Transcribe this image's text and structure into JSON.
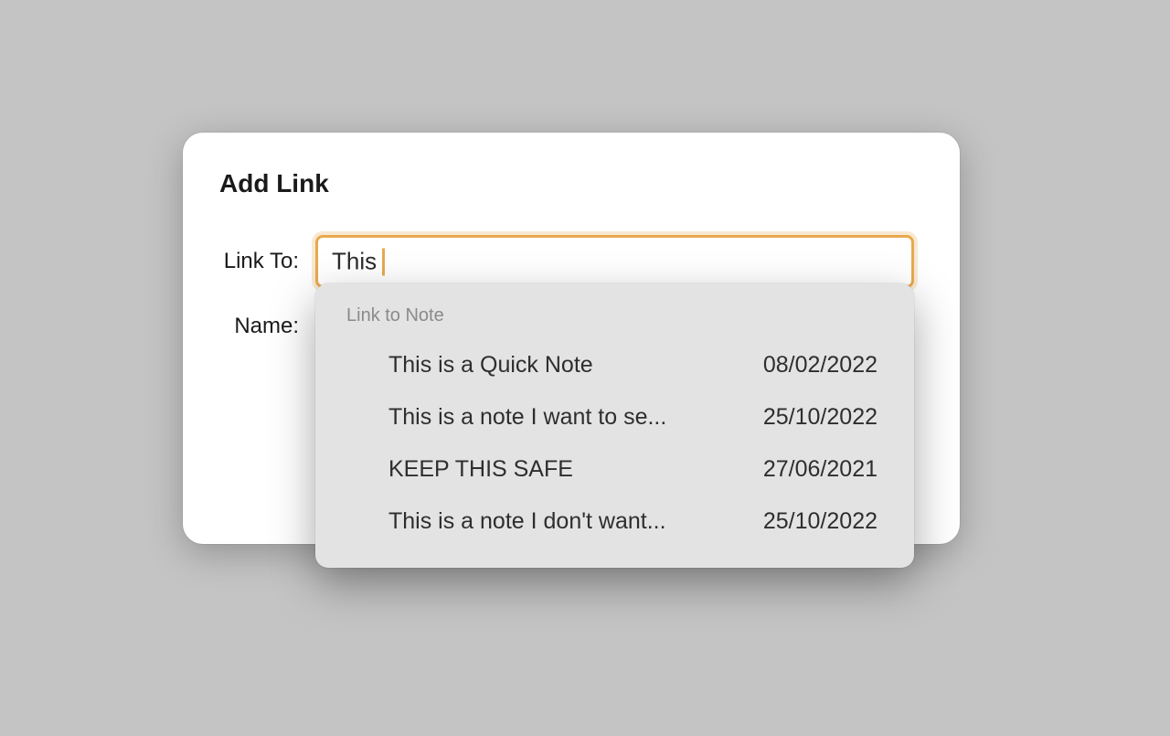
{
  "dialog": {
    "title": "Add Link",
    "linkto_label": "Link To:",
    "name_label": "Name:",
    "linkto_value": "This"
  },
  "dropdown": {
    "header": "Link to Note",
    "items": [
      {
        "title": "This is a Quick Note",
        "date": "08/02/2022"
      },
      {
        "title": "This is a note I want to se...",
        "date": "25/10/2022"
      },
      {
        "title": "KEEP THIS SAFE",
        "date": "27/06/2021"
      },
      {
        "title": "This is a note I don't want...",
        "date": "25/10/2022"
      }
    ]
  }
}
